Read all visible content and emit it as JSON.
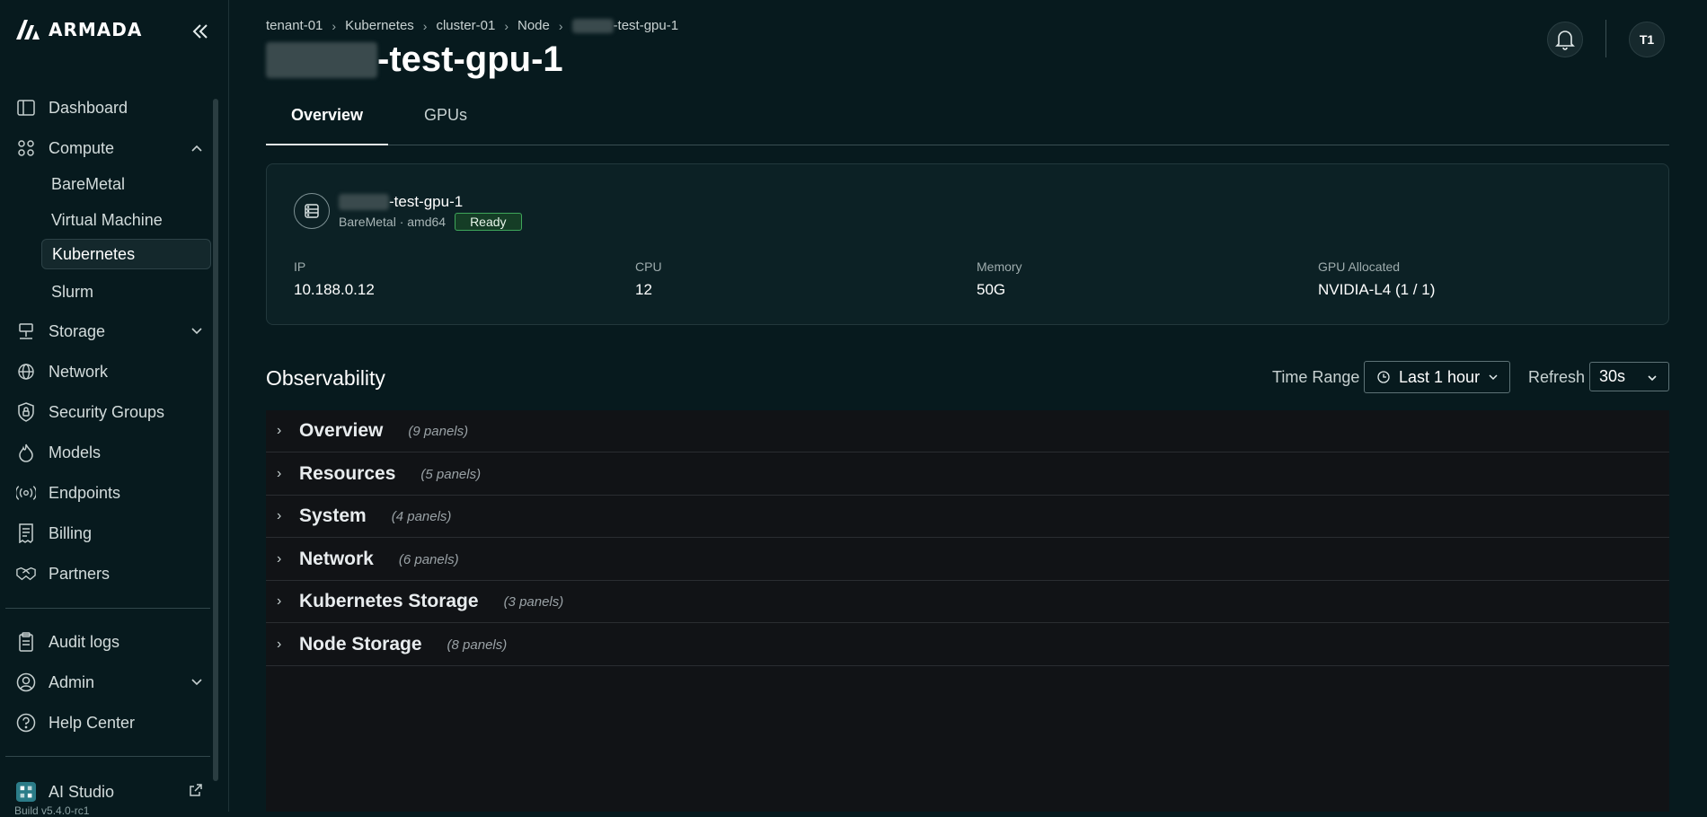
{
  "sidebar": {
    "brand": "ARMADA",
    "items": [
      {
        "label": "Dashboard"
      },
      {
        "label": "Compute"
      },
      {
        "label": "BareMetal"
      },
      {
        "label": "Virtual Machine"
      },
      {
        "label": "Kubernetes"
      },
      {
        "label": "Slurm"
      },
      {
        "label": "Storage"
      },
      {
        "label": "Network"
      },
      {
        "label": "Security Groups"
      },
      {
        "label": "Models"
      },
      {
        "label": "Endpoints"
      },
      {
        "label": "Billing"
      },
      {
        "label": "Partners"
      },
      {
        "label": "Audit logs"
      },
      {
        "label": "Admin"
      },
      {
        "label": "Help Center"
      },
      {
        "label": "AI Studio"
      }
    ],
    "build": "Build v5.4.0-rc1"
  },
  "header": {
    "breadcrumb": [
      "tenant-01",
      "Kubernetes",
      "cluster-01",
      "Node",
      "-test-gpu-1"
    ],
    "title_suffix": "-test-gpu-1",
    "avatar": "T1"
  },
  "tabs": [
    {
      "label": "Overview"
    },
    {
      "label": "GPUs"
    }
  ],
  "node": {
    "name_suffix": "-test-gpu-1",
    "meta": "BareMetal · amd64",
    "status": "Ready",
    "status_color": "#3ea65a",
    "stats": [
      {
        "label": "IP",
        "value": "10.188.0.12"
      },
      {
        "label": "CPU",
        "value": "12"
      },
      {
        "label": "Memory",
        "value": "50G"
      },
      {
        "label": "GPU Allocated",
        "value": "NVIDIA-L4 (1 / 1)"
      }
    ]
  },
  "observability": {
    "title": "Observability",
    "time_range_label": "Time Range",
    "time_range_value": "Last 1 hour",
    "refresh_label": "Refresh",
    "refresh_value": "30s",
    "rows": [
      {
        "name": "Overview",
        "count": "(9 panels)"
      },
      {
        "name": "Resources",
        "count": "(5 panels)"
      },
      {
        "name": "System",
        "count": "(4 panels)"
      },
      {
        "name": "Network",
        "count": "(6 panels)"
      },
      {
        "name": "Kubernetes Storage",
        "count": "(3 panels)"
      },
      {
        "name": "Node Storage",
        "count": "(8 panels)"
      }
    ]
  }
}
